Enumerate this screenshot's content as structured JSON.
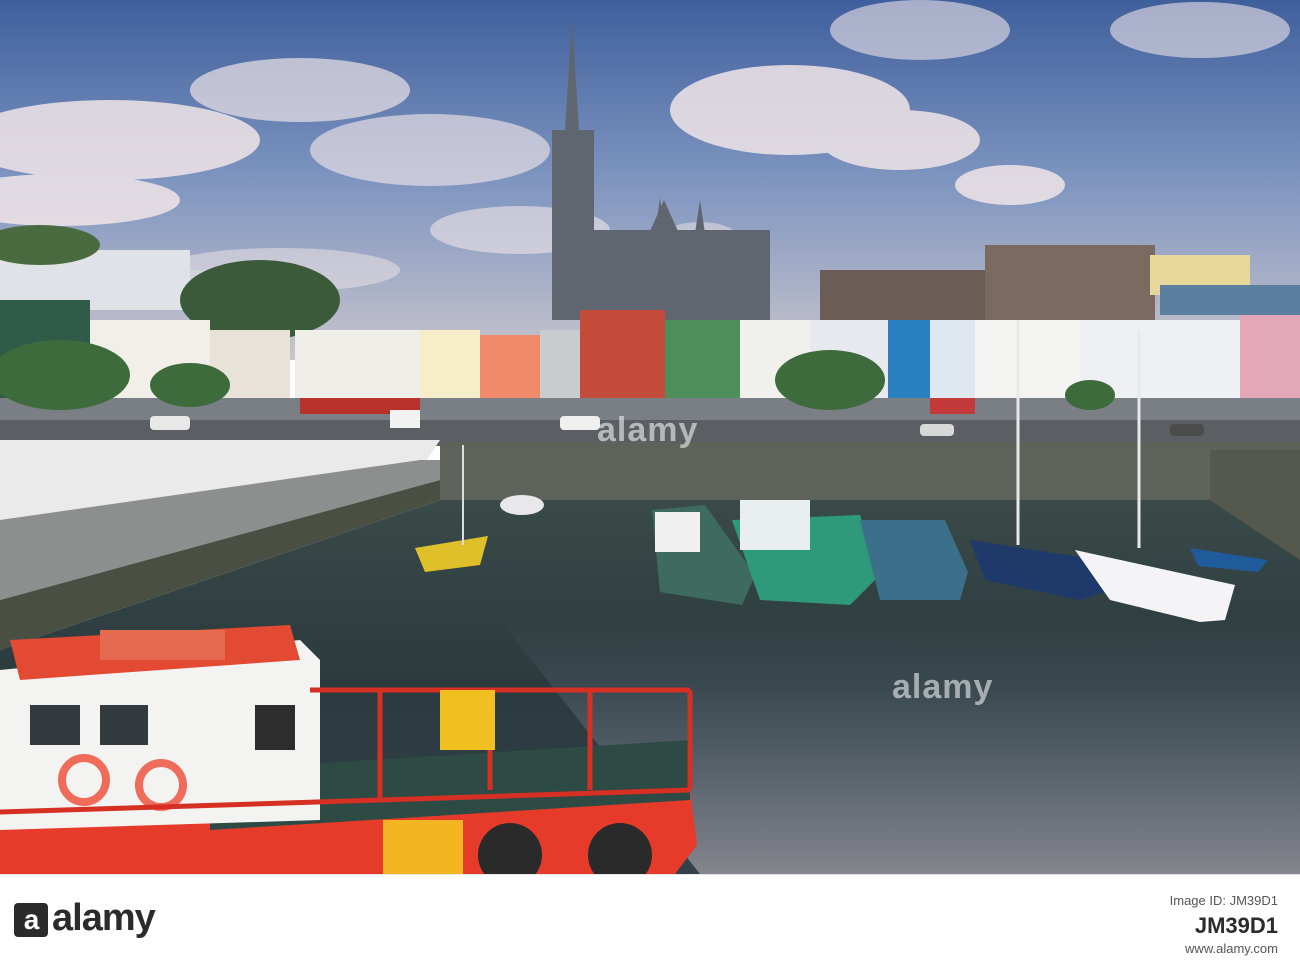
{
  "photo": {
    "alt": "",
    "watermarks": [
      "alamy",
      "alamy"
    ]
  },
  "footer": {
    "logo": "alamy",
    "logo_mark": "a",
    "caption": "",
    "image_id_label": "Image ID: JM39D1",
    "image_id": "JM39D1",
    "url": "www.alamy.com"
  },
  "colors": {
    "sky_top": "#4a6aa3",
    "sky_mid": "#7f96c2",
    "cloud": "#f2e9ea",
    "water": "#2a3a3c",
    "boat_red": "#e63a2a",
    "boat_green": "#2f9a78"
  }
}
